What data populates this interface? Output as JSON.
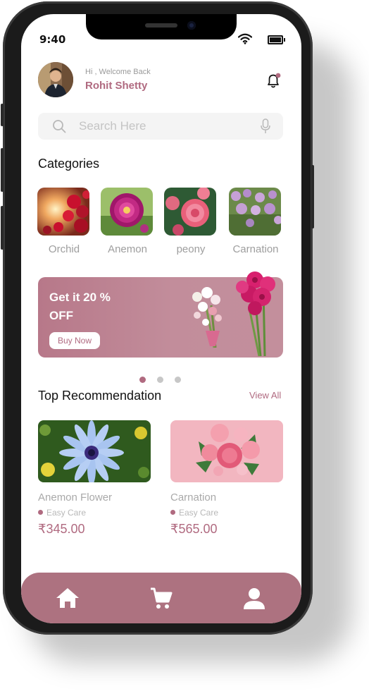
{
  "status": {
    "time": "9:40",
    "wifi_icon": "wifi-icon",
    "battery_icon": "battery-icon"
  },
  "header": {
    "greeting": "Hi , Welcome Back",
    "user_name": "Rohit Shetty",
    "notification_icon": "bell-icon"
  },
  "search": {
    "placeholder": "Search Here",
    "icon": "search-icon",
    "mic_icon": "microphone-icon"
  },
  "categories": {
    "title": "Categories",
    "items": [
      {
        "label": "Orchid"
      },
      {
        "label": "Anemon"
      },
      {
        "label": "peony"
      },
      {
        "label": "Carnation"
      }
    ]
  },
  "banner": {
    "line1": "Get it 20 %",
    "line2": "OFF",
    "button": "Buy Now",
    "active_slide": 1,
    "slide_count": 3
  },
  "recommendations": {
    "title": "Top Recommendation",
    "view_all": "View All",
    "items": [
      {
        "name": "Anemon Flower",
        "care": "Easy Care",
        "price": "₹345.00"
      },
      {
        "name": "Carnation",
        "care": "Easy Care",
        "price": "₹565.00"
      }
    ]
  },
  "bottom_nav": {
    "items": [
      "home-icon",
      "cart-icon",
      "profile-icon"
    ]
  },
  "colors": {
    "accent": "#b06a80",
    "bar": "#ad7280",
    "banner": "#c28d9b"
  }
}
